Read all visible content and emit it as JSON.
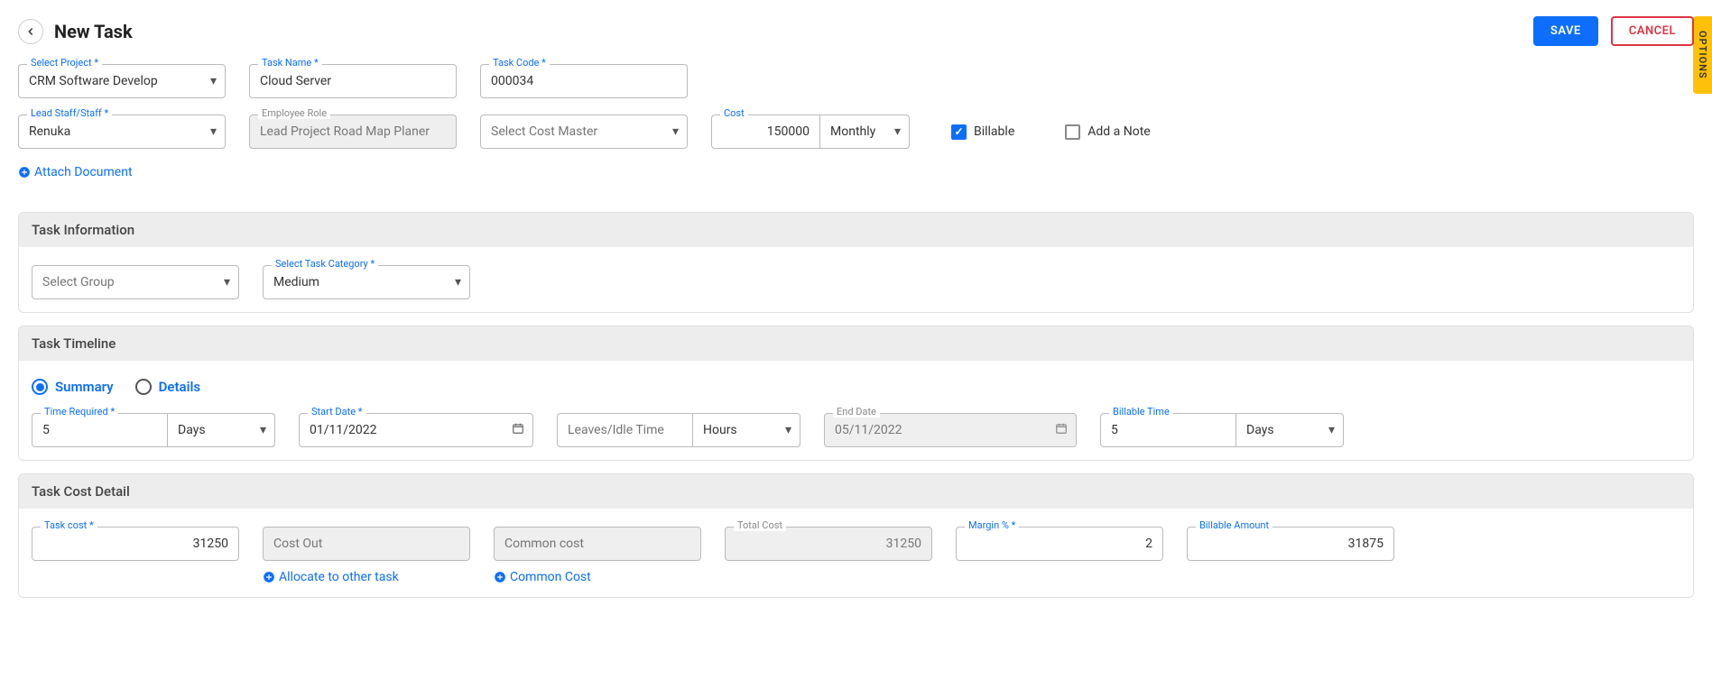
{
  "header": {
    "title": "New Task",
    "save": "SAVE",
    "cancel": "CANCEL",
    "options": "OPTIONS"
  },
  "fields": {
    "project": {
      "label": "Select Project *",
      "value": "CRM Software Develop"
    },
    "taskName": {
      "label": "Task Name *",
      "value": "Cloud Server"
    },
    "taskCode": {
      "label": "Task Code *",
      "value": "000034"
    },
    "leadStaff": {
      "label": "Lead Staff/Staff *",
      "value": "Renuka"
    },
    "employeeRole": {
      "label": "Employee Role",
      "value": "Lead Project Road Map Planer"
    },
    "costMaster": {
      "label": "",
      "placeholder": "Select Cost Master"
    },
    "cost": {
      "label": "Cost",
      "value": "150000",
      "unit": "Monthly"
    },
    "billable": {
      "label": "Billable",
      "checked": true
    },
    "addNote": {
      "label": "Add a Note",
      "checked": false
    },
    "attach": "Attach Document"
  },
  "taskInfo": {
    "title": "Task Information",
    "group": {
      "placeholder": "Select Group"
    },
    "category": {
      "label": "Select Task Category *",
      "value": "Medium"
    }
  },
  "timeline": {
    "title": "Task Timeline",
    "summary": "Summary",
    "details": "Details",
    "timeRequired": {
      "label": "Time Required *",
      "value": "5",
      "unit": "Days"
    },
    "startDate": {
      "label": "Start Date *",
      "value": "01/11/2022"
    },
    "leaves": {
      "placeholder": "Leaves/Idle Time",
      "unit": "Hours"
    },
    "endDate": {
      "label": "End Date",
      "value": "05/11/2022"
    },
    "billableTime": {
      "label": "Billable Time",
      "value": "5",
      "unit": "Days"
    }
  },
  "costDetail": {
    "title": "Task Cost Detail",
    "taskCost": {
      "label": "Task cost *",
      "value": "31250"
    },
    "costOut": {
      "placeholder": "Cost Out"
    },
    "commonCost": {
      "placeholder": "Common cost"
    },
    "totalCost": {
      "label": "Total Cost",
      "value": "31250"
    },
    "margin": {
      "label": "Margin % *",
      "value": "2"
    },
    "billableAmount": {
      "label": "Billable Amount",
      "value": "31875"
    },
    "allocate": "Allocate to other task",
    "commonCostLink": "Common Cost"
  }
}
